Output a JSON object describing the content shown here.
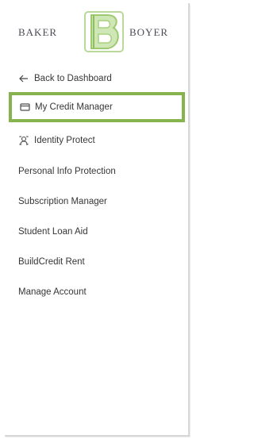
{
  "brand": {
    "left_word": "BAKER",
    "right_word": "BOYER",
    "accent_color": "#86b34e",
    "monogram": "B"
  },
  "menu": {
    "items": [
      {
        "label": "Back to Dashboard",
        "icon": "arrow-left-icon",
        "active": false
      },
      {
        "label": "My Credit Manager",
        "icon": "card-icon",
        "active": true
      },
      {
        "label": "Identity Protect",
        "icon": "identity-icon",
        "active": false
      },
      {
        "label": "Personal Info Protection",
        "icon": "",
        "active": false
      },
      {
        "label": "Subscription Manager",
        "icon": "",
        "active": false
      },
      {
        "label": "Student Loan Aid",
        "icon": "",
        "active": false
      },
      {
        "label": "BuildCredit Rent",
        "icon": "",
        "active": false
      },
      {
        "label": "Manage Account",
        "icon": "",
        "active": false
      }
    ]
  }
}
